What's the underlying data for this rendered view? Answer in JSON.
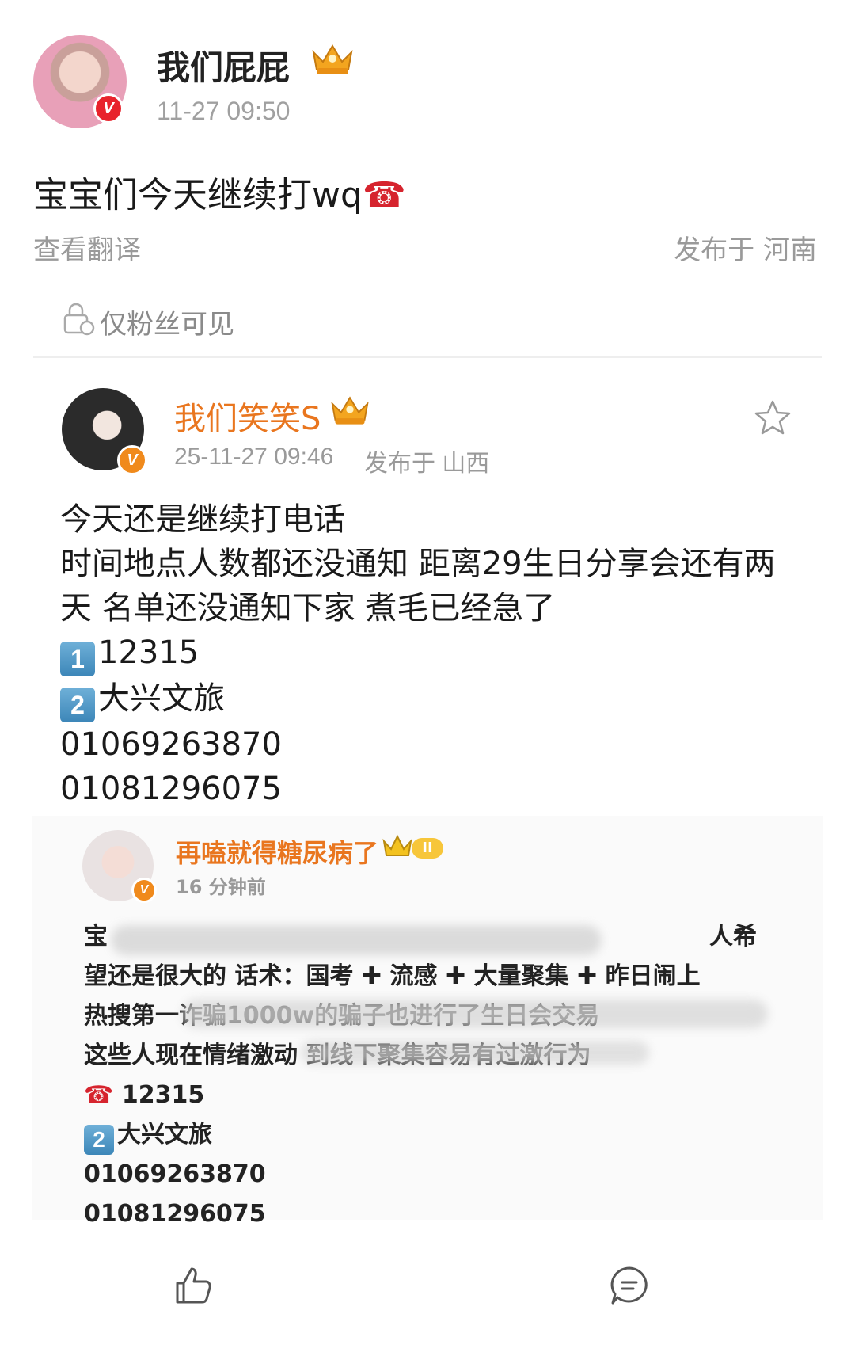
{
  "post": {
    "author": "我们屁屁",
    "time": "11-27 09:50",
    "text": "宝宝们今天继续打wq",
    "text_emoji": "☎",
    "translate_link": "查看翻译",
    "location": "发布于 河南",
    "visibility": "仅粉丝可见"
  },
  "repost": {
    "author": "我们笑笑S",
    "time": "25-11-27 09:46",
    "location": "发布于 山西",
    "lines": [
      "今天还是继续打电话",
      "时间地点人数都还没通知 距离29生日分享会还有两",
      "天 名单还没通知下家 煮毛已经急了"
    ],
    "item1_badge": "1",
    "item1_text": "12315",
    "item2_badge": "2",
    "item2_text": "大兴文旅",
    "phone1": "01069263870",
    "phone2": "01081296075"
  },
  "quoted": {
    "author": "再嗑就得糖尿病了",
    "time": "16 分钟前",
    "level": "II",
    "lines": [
      "宝",
      "人希",
      "望还是很大的 话术：国考",
      "流感",
      "大量聚集",
      "昨日闹上",
      "热搜第一诈骗1000w的骗子也进行了生日会交易",
      "这些人现在情绪激动 到线下聚集容易有过激行为"
    ],
    "item1_text": "12315",
    "item2_badge": "2",
    "item2_text": "大兴文旅",
    "phone1": "01069263870",
    "phone2": "01081296075"
  },
  "colors": {
    "username_orange": "#e9761f",
    "verified_red": "#e8232c",
    "muted_gray": "#9a9a9a"
  },
  "icons": [
    "crown-icon",
    "lock-icon",
    "star-icon",
    "thumbs-up-icon",
    "comment-icon"
  ]
}
